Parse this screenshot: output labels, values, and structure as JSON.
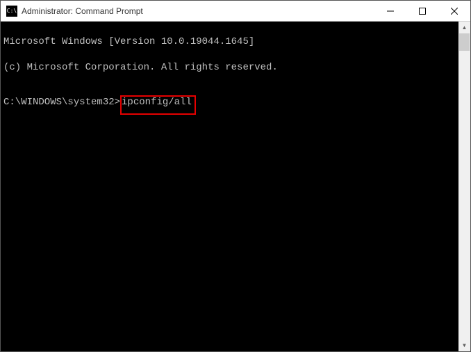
{
  "window": {
    "title": "Administrator: Command Prompt",
    "icon_glyph": "C:\\"
  },
  "terminal": {
    "line1": "Microsoft Windows [Version 10.0.19044.1645]",
    "line2": "(c) Microsoft Corporation. All rights reserved.",
    "prompt": "C:\\WINDOWS\\system32>",
    "command": "ipconfig/all"
  }
}
